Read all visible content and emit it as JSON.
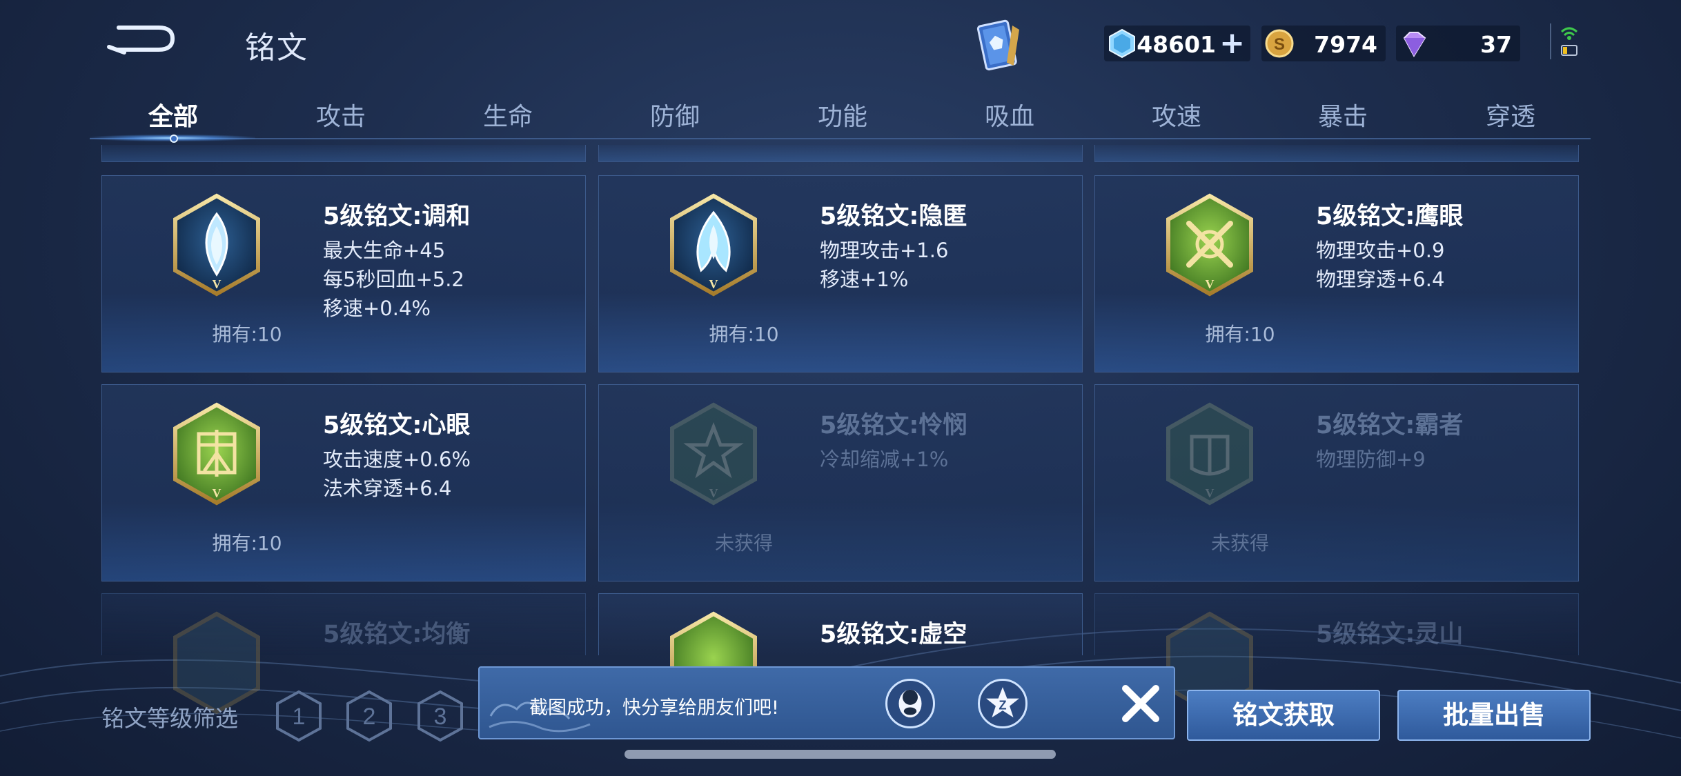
{
  "header": {
    "title": "铭文",
    "currencies": [
      {
        "name": "crystal",
        "value": "48601"
      },
      {
        "name": "gold",
        "value": "7974"
      },
      {
        "name": "gem",
        "value": "37"
      }
    ]
  },
  "tabs": [
    {
      "label": "全部",
      "active": true
    },
    {
      "label": "攻击"
    },
    {
      "label": "生命"
    },
    {
      "label": "防御"
    },
    {
      "label": "功能"
    },
    {
      "label": "吸血"
    },
    {
      "label": "攻速"
    },
    {
      "label": "暴击"
    },
    {
      "label": "穿透"
    }
  ],
  "inscriptions": [
    {
      "name": "5级铭文:调和",
      "stats": [
        "最大生命+45",
        "每5秒回血+5.2",
        "移速+0.4%"
      ],
      "owned": "拥有:10",
      "color": "blue"
    },
    {
      "name": "5级铭文:隐匿",
      "stats": [
        "物理攻击+1.6",
        "移速+1%"
      ],
      "owned": "拥有:10",
      "color": "blue"
    },
    {
      "name": "5级铭文:鹰眼",
      "stats": [
        "物理攻击+0.9",
        "物理穿透+6.4"
      ],
      "owned": "拥有:10",
      "color": "green"
    },
    {
      "name": "5级铭文:心眼",
      "stats": [
        "攻击速度+0.6%",
        "法术穿透+6.4"
      ],
      "owned": "拥有:10",
      "color": "green"
    },
    {
      "name": "5级铭文:怜悯",
      "stats": [
        "冷却缩减+1%"
      ],
      "owned": "未获得",
      "color": "green",
      "locked": true
    },
    {
      "name": "5级铭文:霸者",
      "stats": [
        "物理防御+9"
      ],
      "owned": "未获得",
      "color": "green",
      "locked": true
    },
    {
      "name": "5级铭文:均衡",
      "stats": [],
      "owned": "",
      "faded": true
    },
    {
      "name": "5级铭文:虚空",
      "stats": [],
      "owned": "",
      "partial": true
    },
    {
      "name": "5级铭文:灵山",
      "stats": [],
      "owned": "",
      "faded": true
    }
  ],
  "bottom": {
    "filter_label": "铭文等级筛选",
    "levels": [
      "1",
      "2",
      "3"
    ],
    "toast_text": "截图成功，快分享给朋友们吧!",
    "obtain_label": "铭文获取",
    "sell_label": "批量出售"
  }
}
